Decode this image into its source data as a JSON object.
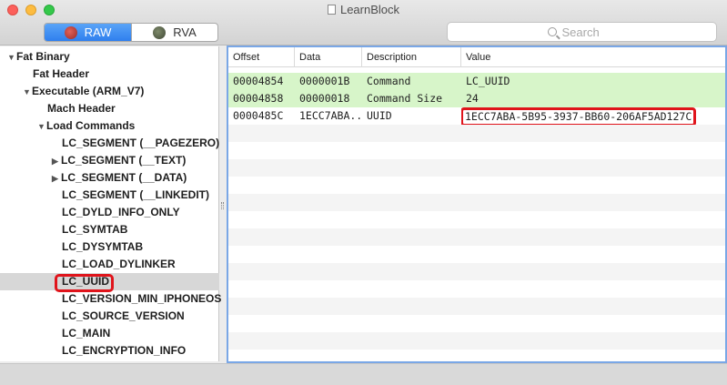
{
  "window": {
    "title": "LearnBlock"
  },
  "toolbar": {
    "segments": [
      {
        "label": "RAW",
        "icon": "apple-red-icon"
      },
      {
        "label": "RVA",
        "icon": "apple-gray-icon"
      }
    ],
    "search_placeholder": "Search"
  },
  "sidebar": {
    "items": [
      {
        "label": "Fat Binary",
        "disclosure": "▼"
      },
      {
        "label": "Fat Header",
        "disclosure": ""
      },
      {
        "label": "Executable  (ARM_V7)",
        "disclosure": "▼"
      },
      {
        "label": "Mach Header",
        "disclosure": ""
      },
      {
        "label": "Load Commands",
        "disclosure": "▼"
      },
      {
        "label": "LC_SEGMENT (__PAGEZERO)",
        "disclosure": ""
      },
      {
        "label": "LC_SEGMENT (__TEXT)",
        "disclosure": "▶"
      },
      {
        "label": "LC_SEGMENT (__DATA)",
        "disclosure": "▶"
      },
      {
        "label": "LC_SEGMENT (__LINKEDIT)",
        "disclosure": ""
      },
      {
        "label": "LC_DYLD_INFO_ONLY",
        "disclosure": ""
      },
      {
        "label": "LC_SYMTAB",
        "disclosure": ""
      },
      {
        "label": "LC_DYSYMTAB",
        "disclosure": ""
      },
      {
        "label": "LC_LOAD_DYLINKER",
        "disclosure": ""
      },
      {
        "label": "LC_UUID",
        "disclosure": ""
      },
      {
        "label": "LC_VERSION_MIN_IPHONEOS",
        "disclosure": ""
      },
      {
        "label": "LC_SOURCE_VERSION",
        "disclosure": ""
      },
      {
        "label": "LC_MAIN",
        "disclosure": ""
      },
      {
        "label": "LC_ENCRYPTION_INFO",
        "disclosure": ""
      }
    ]
  },
  "table": {
    "columns": [
      "Offset",
      "Data",
      "Description",
      "Value"
    ],
    "rows": [
      {
        "offset": "00004854",
        "data": "0000001B",
        "description": "Command",
        "value": "LC_UUID"
      },
      {
        "offset": "00004858",
        "data": "00000018",
        "description": "Command Size",
        "value": "24"
      },
      {
        "offset": "0000485C",
        "data": "1ECC7ABA...",
        "description": "UUID",
        "value": "1ECC7ABA-5B95-3937-BB60-206AF5AD127C"
      }
    ]
  },
  "colors": {
    "accent": "#2f7fee",
    "highlight_row": "#d7f5c9",
    "annotation": "#e0141b"
  }
}
